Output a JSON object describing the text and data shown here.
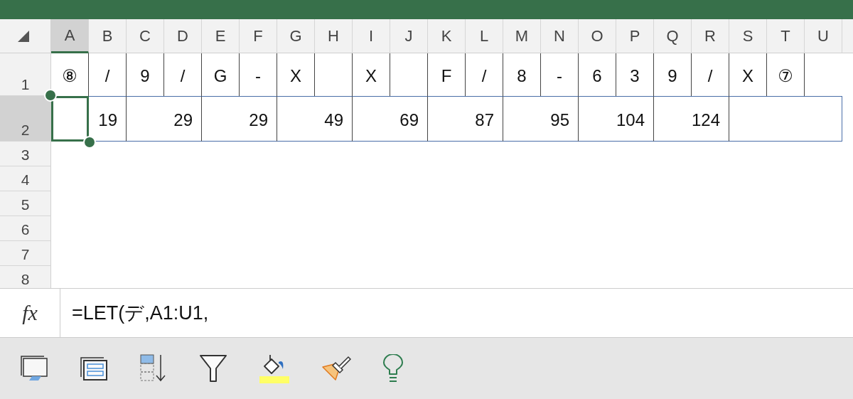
{
  "columns": [
    {
      "label": "A",
      "selected": true
    },
    {
      "label": "B",
      "selected": false
    },
    {
      "label": "C",
      "selected": false
    },
    {
      "label": "D",
      "selected": false
    },
    {
      "label": "E",
      "selected": false
    },
    {
      "label": "F",
      "selected": false
    },
    {
      "label": "G",
      "selected": false
    },
    {
      "label": "H",
      "selected": false
    },
    {
      "label": "I",
      "selected": false
    },
    {
      "label": "J",
      "selected": false
    },
    {
      "label": "K",
      "selected": false
    },
    {
      "label": "L",
      "selected": false
    },
    {
      "label": "M",
      "selected": false
    },
    {
      "label": "N",
      "selected": false
    },
    {
      "label": "O",
      "selected": false
    },
    {
      "label": "P",
      "selected": false
    },
    {
      "label": "Q",
      "selected": false
    },
    {
      "label": "R",
      "selected": false
    },
    {
      "label": "S",
      "selected": false
    },
    {
      "label": "T",
      "selected": false
    },
    {
      "label": "U",
      "selected": false
    }
  ],
  "rows": [
    {
      "label": "1",
      "selected": false,
      "cells": [
        {
          "text": "⑧",
          "selected": false
        },
        {
          "text": "/",
          "selected": false
        },
        {
          "text": "9",
          "selected": false
        },
        {
          "text": "/",
          "selected": false
        },
        {
          "text": "G",
          "selected": false
        },
        {
          "text": "-",
          "selected": false
        },
        {
          "text": "X",
          "selected": false
        },
        {
          "selected": false
        },
        {
          "text": "X",
          "selected": false
        },
        {
          "selected": false
        },
        {
          "text": "F",
          "selected": false
        },
        {
          "text": "/",
          "selected": false
        },
        {
          "text": "8",
          "selected": false
        },
        {
          "text": "-",
          "selected": false
        },
        {
          "text": "6",
          "selected": false
        },
        {
          "text": "3",
          "selected": false
        },
        {
          "text": "9",
          "selected": false
        },
        {
          "text": "/",
          "selected": false
        },
        {
          "text": "X",
          "selected": false
        },
        {
          "text": "⑦",
          "selected": false
        },
        {
          "selected": false
        }
      ]
    },
    {
      "label": "2",
      "selected": true,
      "cells": [
        {
          "kind": "single",
          "selected": true
        },
        {
          "kind": "single",
          "text": "19",
          "selected": false
        },
        {
          "kind": "merged-pair",
          "text": "29",
          "selected": false
        },
        {
          "kind": "merged-pair",
          "text": "29",
          "selected": false
        },
        {
          "kind": "merged-pair",
          "text": "49",
          "selected": false
        },
        {
          "kind": "merged-pair",
          "text": "69",
          "selected": false
        },
        {
          "kind": "merged-pair",
          "text": "87",
          "selected": false
        },
        {
          "kind": "merged-pair",
          "text": "95",
          "selected": false
        },
        {
          "kind": "merged-pair",
          "text": "104",
          "selected": false
        },
        {
          "kind": "merged-pair",
          "text": "124",
          "selected": false
        },
        {
          "kind": "merged-triple",
          "selected": false
        }
      ]
    },
    {
      "label": "3",
      "selected": false
    },
    {
      "label": "4",
      "selected": false
    },
    {
      "label": "5",
      "selected": false
    },
    {
      "label": "6",
      "selected": false
    },
    {
      "label": "7",
      "selected": false
    },
    {
      "label": "8",
      "selected": false
    }
  ],
  "formula_bar": {
    "icon_text": "fx",
    "formula": "=LET(デ,A1:U1,"
  }
}
